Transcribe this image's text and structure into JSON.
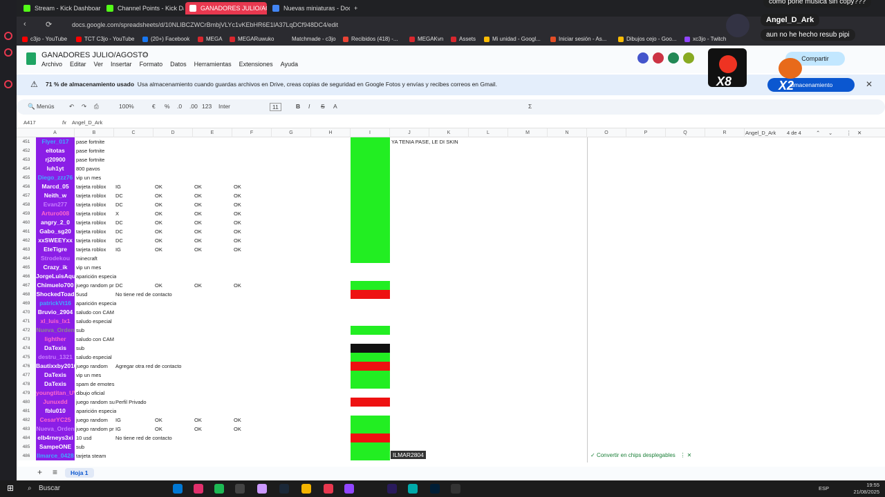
{
  "browser": {
    "tabs": [
      {
        "label": "Stream - Kick Dashboard",
        "color": "#53fc18"
      },
      {
        "label": "Channel Points - Kick Da",
        "color": "#53fc18"
      },
      {
        "label": "GANADORES JULIO/AGO",
        "color": "#1fa463",
        "active": true
      },
      {
        "label": "Nuevas miniaturas - Docu",
        "color": "#4285f4"
      }
    ],
    "url": "docs.google.com/spreadsheets/d/10NLIBCZWCrBmbjVLYc1vKEbHR6E1lA37LqDCf948DC4/edit",
    "bookmarks": [
      {
        "label": "c3jo - YouTube",
        "color": "#ff0000"
      },
      {
        "label": "TCT C3jo - YouTube",
        "color": "#ff0000"
      },
      {
        "label": "(20+) Facebook",
        "color": "#1877f2"
      },
      {
        "label": "MEGA",
        "color": "#d9272e"
      },
      {
        "label": "MEGARuwuko",
        "color": "#d9272e"
      },
      {
        "label": "Matchmade - c3jo",
        "color": "#333333"
      },
      {
        "label": "Recibidos (418) -...",
        "color": "#ea4335"
      },
      {
        "label": "MEGAKvn",
        "color": "#d9272e"
      },
      {
        "label": "Assets",
        "color": "#d9272e"
      },
      {
        "label": "Mi unidad - Googl...",
        "color": "#fbbc04"
      },
      {
        "label": "Iniciar sesión - As...",
        "color": "#e44d26"
      },
      {
        "label": "Dibujos cejo - Goo...",
        "color": "#fbbc04"
      },
      {
        "label": "xc3jo - Twitch",
        "color": "#9146ff"
      }
    ]
  },
  "doc": {
    "title": "GANADORES JULIO/AGOSTO",
    "menu": [
      "Archivo",
      "Editar",
      "Ver",
      "Insertar",
      "Formato",
      "Datos",
      "Herramientas",
      "Extensiones",
      "Ayuda"
    ],
    "share_label": "Compartir"
  },
  "banner": {
    "bold": "71 % de almacenamiento usado",
    "text": "Usa almacenamiento cuando guardas archivos en Drive, creas copias de seguridad en Google Fotos y envías y recibes correos en Gmail.",
    "button": "almacenamiento"
  },
  "toolbar": {
    "menus": "Menús",
    "zoom": "100%",
    "currency": "€",
    "percent": "%",
    "dec1": ".0",
    "dec2": ".00",
    "numfmt": "123",
    "font": "Inter",
    "size": "11"
  },
  "formula_bar": {
    "cell_ref": "A417",
    "content": "Angel_D_Ark"
  },
  "find": {
    "query": "Angel_D_Ark",
    "count": "4 de 4"
  },
  "columns": [
    "A",
    "B",
    "C",
    "D",
    "E",
    "F",
    "G",
    "H",
    "I",
    "J",
    "K",
    "L",
    "M",
    "N",
    "O",
    "P",
    "Q",
    "R"
  ],
  "rows": [
    {
      "n": "451",
      "a": "Flyer_017",
      "ac": "#3fa9ff",
      "b": "pase fortnite",
      "c": "",
      "d": "",
      "e": "",
      "f": "",
      "i": "#22ee22",
      "j": "YA TENIA PASE, LE DI SKIN"
    },
    {
      "n": "452",
      "a": "eltotas",
      "ac": "#ffffff",
      "b": "pase fortnite",
      "c": "",
      "d": "",
      "e": "",
      "f": "",
      "i": "#22ee22",
      "j": ""
    },
    {
      "n": "453",
      "a": "rj20900",
      "ac": "#ffffff",
      "b": "pase fortnite",
      "c": "",
      "d": "",
      "e": "",
      "f": "",
      "i": "#22ee22",
      "j": ""
    },
    {
      "n": "454",
      "a": "luh1yt",
      "ac": "#ffffff",
      "b": "800 pavos",
      "c": "",
      "d": "",
      "e": "",
      "f": "",
      "i": "#22ee22",
      "j": ""
    },
    {
      "n": "455",
      "a": "Diego_zzz76",
      "ac": "#3fa9ff",
      "b": "vip un mes",
      "c": "",
      "d": "",
      "e": "",
      "f": "",
      "i": "#22ee22",
      "j": ""
    },
    {
      "n": "456",
      "a": "Marcd_05",
      "ac": "#ffffff",
      "b": "tarjeta roblox",
      "c": "IG",
      "d": "OK",
      "e": "OK",
      "f": "OK",
      "i": "#22ee22",
      "j": ""
    },
    {
      "n": "457",
      "a": "Neith_w",
      "ac": "#ffffff",
      "b": "tarjeta roblox",
      "c": "DC",
      "d": "OK",
      "e": "OK",
      "f": "OK",
      "i": "#22ee22",
      "j": ""
    },
    {
      "n": "458",
      "a": "Evan277",
      "ac": "#c77dff",
      "b": "tarjeta roblox",
      "c": "DC",
      "d": "OK",
      "e": "OK",
      "f": "OK",
      "i": "#22ee22",
      "j": ""
    },
    {
      "n": "459",
      "a": "Arturo008",
      "ac": "#ff66cc",
      "b": "tarjeta roblox",
      "c": "X",
      "d": "OK",
      "e": "OK",
      "f": "OK",
      "i": "#22ee22",
      "j": ""
    },
    {
      "n": "460",
      "a": "angry_2_0",
      "ac": "#ffffff",
      "b": "tarjeta roblox",
      "c": "DC",
      "d": "OK",
      "e": "OK",
      "f": "OK",
      "i": "#22ee22",
      "j": ""
    },
    {
      "n": "461",
      "a": "Gabo_sg20",
      "ac": "#ffffff",
      "b": "tarjeta roblox",
      "c": "DC",
      "d": "OK",
      "e": "OK",
      "f": "OK",
      "i": "#22ee22",
      "j": ""
    },
    {
      "n": "462",
      "a": "xxSWEEYxx",
      "ac": "#ffffff",
      "b": "tarjeta roblox",
      "c": "DC",
      "d": "OK",
      "e": "OK",
      "f": "OK",
      "i": "#22ee22",
      "j": ""
    },
    {
      "n": "463",
      "a": "EteTigre",
      "ac": "#ffffff",
      "b": "tarjeta roblox",
      "c": "IG",
      "d": "OK",
      "e": "OK",
      "f": "OK",
      "i": "#22ee22",
      "j": ""
    },
    {
      "n": "464",
      "a": "Strodekou",
      "ac": "#c77dff",
      "b": "minecraft",
      "c": "",
      "d": "",
      "e": "",
      "f": "",
      "i": "#22ee22",
      "j": ""
    },
    {
      "n": "465",
      "a": "Crazy_ik",
      "ac": "#ffffff",
      "b": "vip un mes",
      "c": "",
      "d": "",
      "e": "",
      "f": "",
      "i": "",
      "j": ""
    },
    {
      "n": "466",
      "a": "JorgeLuisAquino",
      "ac": "#ffffff",
      "b": "aparición especial",
      "c": "",
      "d": "",
      "e": "",
      "f": "",
      "i": "",
      "j": ""
    },
    {
      "n": "467",
      "a": "Chimuelo700",
      "ac": "#ffffff",
      "b": "juego random pr",
      "c": "DC",
      "d": "OK",
      "e": "OK",
      "f": "OK",
      "i": "#22ee22",
      "j": ""
    },
    {
      "n": "468",
      "a": "ShockedToad",
      "ac": "#ffffff",
      "b": "5usd",
      "c": "No tiene red de contacto",
      "d": "",
      "e": "",
      "f": "",
      "i": "#ee1111",
      "j": ""
    },
    {
      "n": "469",
      "a": "patrickVt16",
      "ac": "#3fa9ff",
      "b": "aparición especial",
      "c": "",
      "d": "",
      "e": "",
      "f": "",
      "i": "",
      "j": ""
    },
    {
      "n": "470",
      "a": "Bruvio_2904",
      "ac": "#ffffff",
      "b": "saludo con CAM",
      "c": "",
      "d": "",
      "e": "",
      "f": "",
      "i": "",
      "j": ""
    },
    {
      "n": "471",
      "a": "xl_luis_lx1",
      "ac": "#ff66cc",
      "b": "saludo especial",
      "c": "",
      "d": "",
      "e": "",
      "f": "",
      "i": "",
      "j": ""
    },
    {
      "n": "472",
      "a": "Nueva_Orden",
      "ac": "#8a8a8a",
      "b": "sub",
      "c": "",
      "d": "",
      "e": "",
      "f": "",
      "i": "#22ee22",
      "j": ""
    },
    {
      "n": "473",
      "a": "lighther",
      "ac": "#ff66cc",
      "b": "saludo con CAM",
      "c": "",
      "d": "",
      "e": "",
      "f": "",
      "i": "",
      "j": ""
    },
    {
      "n": "474",
      "a": "DaTexis",
      "ac": "#ffffff",
      "b": "sub",
      "c": "",
      "d": "",
      "e": "",
      "f": "",
      "i": "#111111",
      "j": ""
    },
    {
      "n": "475",
      "a": "destru_1321",
      "ac": "#c77dff",
      "b": "saludo especial",
      "c": "",
      "d": "",
      "e": "",
      "f": "",
      "i": "#22ee22",
      "j": ""
    },
    {
      "n": "476",
      "a": "Bautixxby2010",
      "ac": "#ffffff",
      "b": "juego random",
      "c": "Agregar otra red de contacto",
      "d": "",
      "e": "",
      "f": "",
      "i": "#ee1111",
      "j": ""
    },
    {
      "n": "477",
      "a": "DaTexis",
      "ac": "#ffffff",
      "b": "vip un mes",
      "c": "",
      "d": "",
      "e": "",
      "f": "",
      "i": "#22ee22",
      "j": ""
    },
    {
      "n": "478",
      "a": "DaTexis",
      "ac": "#ffffff",
      "b": "spam de emotes",
      "c": "",
      "d": "",
      "e": "",
      "f": "",
      "i": "#22ee22",
      "j": ""
    },
    {
      "n": "479",
      "a": "youngtitan_UV",
      "ac": "#ff66cc",
      "b": "dibujo oficial",
      "c": "",
      "d": "",
      "e": "",
      "f": "",
      "i": "",
      "j": ""
    },
    {
      "n": "480",
      "a": "Junuxdd",
      "ac": "#ff66cc",
      "b": "juego random su",
      "c": "Perfil Privado",
      "d": "",
      "e": "",
      "f": "",
      "i": "#ee1111",
      "j": ""
    },
    {
      "n": "481",
      "a": "fblu010",
      "ac": "#ffffff",
      "b": "aparición especial",
      "c": "",
      "d": "",
      "e": "",
      "f": "",
      "i": "",
      "j": ""
    },
    {
      "n": "482",
      "a": "CesarYC25",
      "ac": "#ff66cc",
      "b": "juego random",
      "c": "IG",
      "d": "OK",
      "e": "OK",
      "f": "OK",
      "i": "#22ee22",
      "j": ""
    },
    {
      "n": "483",
      "a": "Nueva_Orden",
      "ac": "#c77dff",
      "b": "juego random pr",
      "c": "IG",
      "d": "OK",
      "e": "OK",
      "f": "OK",
      "i": "#22ee22",
      "j": ""
    },
    {
      "n": "484",
      "a": "elb4rneys3xi",
      "ac": "#ffffff",
      "b": "10 usd",
      "c": "No tiene red de contacto",
      "d": "",
      "e": "",
      "f": "",
      "i": "#ee1111",
      "j": ""
    },
    {
      "n": "485",
      "a": "SampeONE",
      "ac": "#ffffff",
      "b": "sub",
      "c": "",
      "d": "",
      "e": "",
      "f": "",
      "i": "#22ee22",
      "j": ""
    },
    {
      "n": "486",
      "a": "llmarce_0428",
      "ac": "#3fa9ff",
      "b": "tarjeta steam",
      "c": "",
      "d": "",
      "e": "",
      "f": "",
      "i": "#22ee22",
      "j": ""
    }
  ],
  "tooltip_ilmar": "ILMAR2804",
  "chips_hint": "Convertir en chips desplegables",
  "sheet_tab": "Hoja 1",
  "taskbar": {
    "search": "Buscar",
    "lang": "ESP",
    "time": "19:55",
    "date": "21/08/2025"
  },
  "overlay": {
    "top_msg": "como pone musica sin copy???",
    "user": "Angel_D_Ark",
    "msg": "aun no he hecho resub pipi",
    "x8": "X8",
    "x2": "X2"
  }
}
